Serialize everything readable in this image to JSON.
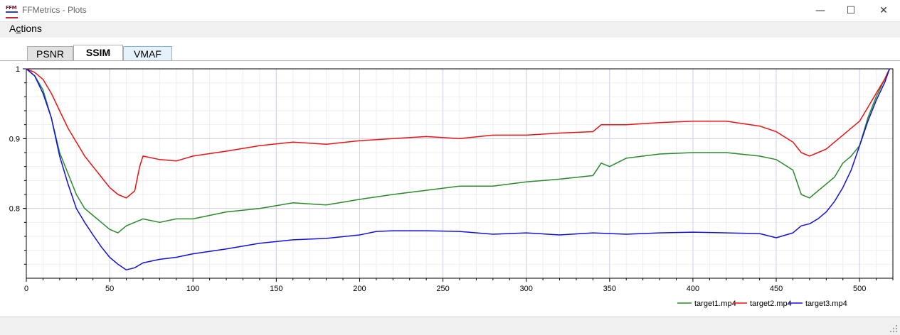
{
  "window": {
    "title": "FFMetrics - Plots",
    "minimize_glyph": "—",
    "maximize_glyph": "☐",
    "close_glyph": "✕"
  },
  "menu": {
    "actions_prefix": "A",
    "actions_accel": "c",
    "actions_suffix": "tions"
  },
  "tabs": [
    {
      "label": "PSNR",
      "state": "inactive"
    },
    {
      "label": "SSIM",
      "state": "selected"
    },
    {
      "label": "VMAF",
      "state": "hover"
    }
  ],
  "colors": {
    "target1": "#2a8a2a",
    "target2": "#ee1111",
    "target3": "#1111dd",
    "grid_major": "#d0d0e8",
    "grid_minor": "#eeeeee"
  },
  "chart_data": {
    "type": "line",
    "title": "",
    "xlabel": "",
    "ylabel": "",
    "xlim": [
      0,
      520
    ],
    "ylim": [
      0.7,
      1.0
    ],
    "x_ticks": [
      0,
      50,
      100,
      150,
      200,
      250,
      300,
      350,
      400,
      450,
      500
    ],
    "y_ticks": [
      0.8,
      0.9,
      1
    ],
    "y_tick_labels": [
      "0.8",
      "0.9",
      "1"
    ],
    "grid": true,
    "legend": "bottom-right",
    "series": [
      {
        "name": "target1.mp4",
        "color": "#2a8a2a",
        "points": [
          [
            0,
            1.0
          ],
          [
            5,
            0.99
          ],
          [
            10,
            0.97
          ],
          [
            15,
            0.93
          ],
          [
            20,
            0.88
          ],
          [
            25,
            0.85
          ],
          [
            30,
            0.82
          ],
          [
            35,
            0.8
          ],
          [
            40,
            0.79
          ],
          [
            45,
            0.78
          ],
          [
            50,
            0.77
          ],
          [
            55,
            0.765
          ],
          [
            60,
            0.775
          ],
          [
            65,
            0.78
          ],
          [
            70,
            0.785
          ],
          [
            80,
            0.78
          ],
          [
            90,
            0.785
          ],
          [
            100,
            0.785
          ],
          [
            120,
            0.795
          ],
          [
            140,
            0.8
          ],
          [
            160,
            0.808
          ],
          [
            180,
            0.805
          ],
          [
            200,
            0.813
          ],
          [
            220,
            0.82
          ],
          [
            240,
            0.826
          ],
          [
            260,
            0.832
          ],
          [
            280,
            0.832
          ],
          [
            300,
            0.838
          ],
          [
            320,
            0.842
          ],
          [
            340,
            0.847
          ],
          [
            345,
            0.865
          ],
          [
            350,
            0.86
          ],
          [
            360,
            0.872
          ],
          [
            380,
            0.878
          ],
          [
            400,
            0.88
          ],
          [
            420,
            0.88
          ],
          [
            440,
            0.875
          ],
          [
            450,
            0.87
          ],
          [
            460,
            0.855
          ],
          [
            465,
            0.82
          ],
          [
            470,
            0.815
          ],
          [
            475,
            0.825
          ],
          [
            480,
            0.835
          ],
          [
            485,
            0.845
          ],
          [
            490,
            0.865
          ],
          [
            495,
            0.875
          ],
          [
            500,
            0.89
          ],
          [
            505,
            0.93
          ],
          [
            510,
            0.96
          ],
          [
            515,
            0.985
          ],
          [
            518,
            1.0
          ]
        ]
      },
      {
        "name": "target2.mp4",
        "color": "#ee1111",
        "points": [
          [
            0,
            1.0
          ],
          [
            5,
            0.995
          ],
          [
            10,
            0.985
          ],
          [
            15,
            0.965
          ],
          [
            20,
            0.94
          ],
          [
            25,
            0.915
          ],
          [
            30,
            0.895
          ],
          [
            35,
            0.875
          ],
          [
            40,
            0.86
          ],
          [
            45,
            0.845
          ],
          [
            50,
            0.83
          ],
          [
            55,
            0.82
          ],
          [
            60,
            0.815
          ],
          [
            65,
            0.825
          ],
          [
            68,
            0.86
          ],
          [
            70,
            0.875
          ],
          [
            80,
            0.87
          ],
          [
            90,
            0.868
          ],
          [
            100,
            0.875
          ],
          [
            120,
            0.882
          ],
          [
            140,
            0.89
          ],
          [
            160,
            0.895
          ],
          [
            180,
            0.892
          ],
          [
            200,
            0.897
          ],
          [
            220,
            0.9
          ],
          [
            240,
            0.903
          ],
          [
            260,
            0.9
          ],
          [
            280,
            0.905
          ],
          [
            300,
            0.905
          ],
          [
            320,
            0.908
          ],
          [
            340,
            0.91
          ],
          [
            345,
            0.92
          ],
          [
            360,
            0.92
          ],
          [
            380,
            0.923
          ],
          [
            400,
            0.925
          ],
          [
            420,
            0.925
          ],
          [
            440,
            0.918
          ],
          [
            450,
            0.91
          ],
          [
            460,
            0.895
          ],
          [
            465,
            0.88
          ],
          [
            470,
            0.875
          ],
          [
            475,
            0.88
          ],
          [
            480,
            0.885
          ],
          [
            485,
            0.895
          ],
          [
            490,
            0.905
          ],
          [
            495,
            0.915
          ],
          [
            500,
            0.925
          ],
          [
            505,
            0.945
          ],
          [
            510,
            0.965
          ],
          [
            515,
            0.985
          ],
          [
            518,
            1.0
          ]
        ]
      },
      {
        "name": "target3.mp4",
        "color": "#1111dd",
        "points": [
          [
            0,
            1.0
          ],
          [
            5,
            0.99
          ],
          [
            10,
            0.965
          ],
          [
            15,
            0.93
          ],
          [
            20,
            0.875
          ],
          [
            25,
            0.835
          ],
          [
            30,
            0.8
          ],
          [
            35,
            0.78
          ],
          [
            40,
            0.762
          ],
          [
            45,
            0.745
          ],
          [
            50,
            0.73
          ],
          [
            55,
            0.72
          ],
          [
            60,
            0.712
          ],
          [
            65,
            0.715
          ],
          [
            70,
            0.722
          ],
          [
            80,
            0.727
          ],
          [
            90,
            0.73
          ],
          [
            100,
            0.735
          ],
          [
            120,
            0.742
          ],
          [
            140,
            0.75
          ],
          [
            160,
            0.755
          ],
          [
            180,
            0.757
          ],
          [
            200,
            0.762
          ],
          [
            210,
            0.767
          ],
          [
            220,
            0.768
          ],
          [
            240,
            0.768
          ],
          [
            260,
            0.767
          ],
          [
            280,
            0.763
          ],
          [
            300,
            0.765
          ],
          [
            320,
            0.762
          ],
          [
            340,
            0.765
          ],
          [
            360,
            0.763
          ],
          [
            380,
            0.765
          ],
          [
            400,
            0.766
          ],
          [
            420,
            0.765
          ],
          [
            440,
            0.764
          ],
          [
            450,
            0.758
          ],
          [
            460,
            0.765
          ],
          [
            465,
            0.775
          ],
          [
            470,
            0.778
          ],
          [
            475,
            0.785
          ],
          [
            480,
            0.795
          ],
          [
            485,
            0.81
          ],
          [
            490,
            0.83
          ],
          [
            495,
            0.855
          ],
          [
            500,
            0.89
          ],
          [
            505,
            0.925
          ],
          [
            510,
            0.955
          ],
          [
            515,
            0.98
          ],
          [
            518,
            1.0
          ]
        ]
      }
    ]
  }
}
